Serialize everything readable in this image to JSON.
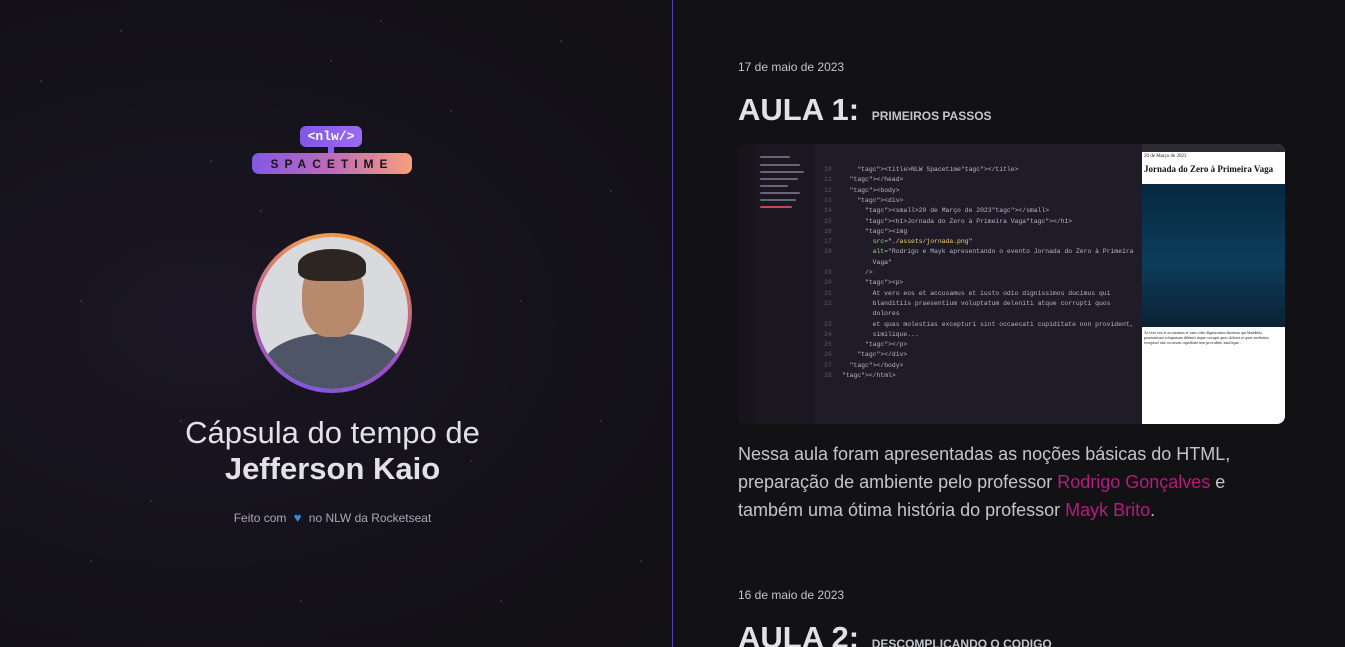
{
  "profile": {
    "logo_tag": "<nlw/>",
    "logo_text": "SPACETIME",
    "title_prefix": "Cápsula do tempo de",
    "name": "Jefferson Kaio",
    "footer_before": "Feito com",
    "footer_after": "no NLW da Rocketseat"
  },
  "memories": [
    {
      "date": "17 de maio de 2023",
      "title": "AULA 1:",
      "subtitle": "PRIMEIROS PASSOS",
      "description_part1": "Nessa aula foram apresentadas as noções básicas do HTML, preparação de ambiente pelo professor ",
      "link1": "Rodrigo Gonçalves",
      "description_part2": " e também uma ótima história do professor ",
      "link2": "Mayk Brito",
      "description_end": "."
    },
    {
      "date": "16 de maio de 2023",
      "title": "AULA 2:",
      "subtitle": "DESCOMPLICANDO O CODIGO"
    }
  ],
  "screenshot": {
    "browser_date": "20 de Março de 2023",
    "browser_heading": "Jornada do Zero à Primeira Vaga",
    "code_lines": [
      {
        "n": "10",
        "text": "    <title>NLW Spacetime</title>"
      },
      {
        "n": "11",
        "text": "  </head>"
      },
      {
        "n": "12",
        "text": "  <body>"
      },
      {
        "n": "13",
        "text": "    <div>"
      },
      {
        "n": "14",
        "text": "      <small>20 de Março de 2023</small>"
      },
      {
        "n": "15",
        "text": "      <h1>Jornada do Zero à Primeira Vaga</h1>"
      },
      {
        "n": "16",
        "text": "      <img"
      },
      {
        "n": "17",
        "text": "        src=\"./assets/jornada.png\""
      },
      {
        "n": "18",
        "text": "        alt=\"Rodrigo e Mayk apresentando o evento Jornada do Zero à Primeira"
      },
      {
        "n": "",
        "text": "        Vaga\""
      },
      {
        "n": "19",
        "text": "      />"
      },
      {
        "n": "20",
        "text": "      <p>"
      },
      {
        "n": "21",
        "text": "        At vero eos et accusamus et iusto odio dignissimos ducimus qui"
      },
      {
        "n": "22",
        "text": "        blanditiis praesentium voluptatum deleniti atque corrupti quos"
      },
      {
        "n": "",
        "text": "        dolores"
      },
      {
        "n": "23",
        "text": "        et quas molestias excepturi sint occaecati cupiditate non provident,"
      },
      {
        "n": "24",
        "text": "        similique..."
      },
      {
        "n": "25",
        "text": "      </p>"
      },
      {
        "n": "26",
        "text": "    </div>"
      },
      {
        "n": "27",
        "text": "  </body>"
      },
      {
        "n": "28",
        "text": "</html>"
      }
    ]
  },
  "colors": {
    "link": "#b41b7f",
    "heart": "#2f8fe8",
    "divider": "#5b3fb0"
  }
}
